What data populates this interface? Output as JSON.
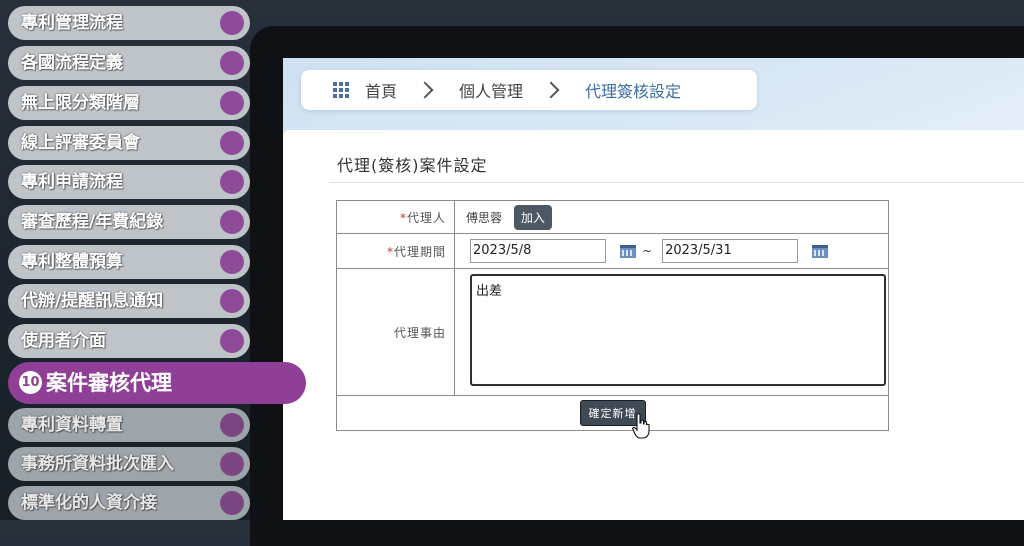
{
  "menu": {
    "items": [
      {
        "label": "專利管理流程"
      },
      {
        "label": "各國流程定義"
      },
      {
        "label": "無上限分類階層"
      },
      {
        "label": "線上評審委員會"
      },
      {
        "label": "專利申請流程"
      },
      {
        "label": "審查歷程/年費紀錄"
      },
      {
        "label": "專利整體預算"
      },
      {
        "label": "代辦/提醒訊息通知"
      },
      {
        "label": "使用者介面"
      },
      {
        "label": "案件審核代理",
        "number": "10"
      },
      {
        "label": "專利資料轉置"
      },
      {
        "label": "事務所資料批次匯入"
      },
      {
        "label": "標準化的人資介接"
      }
    ]
  },
  "breadcrumb": {
    "home": "首頁",
    "level2": "個人管理",
    "current": "代理簽核設定"
  },
  "form": {
    "title": "代理(簽核)案件設定",
    "agent_label": "代理人",
    "agent_value": "傅思蓉",
    "add_button": "加入",
    "period_label": "代理期間",
    "start_date": "2023/5/8",
    "end_date": "2023/5/31",
    "tilde": "~",
    "reason_label": "代理事由",
    "reason_value": "出差",
    "confirm_button": "確定新增",
    "required_mark": "*"
  },
  "colors": {
    "menu_accent": "#8f3f96",
    "menu_dot": "#8e4c98",
    "breadcrumb_active": "#3b6ea5"
  }
}
